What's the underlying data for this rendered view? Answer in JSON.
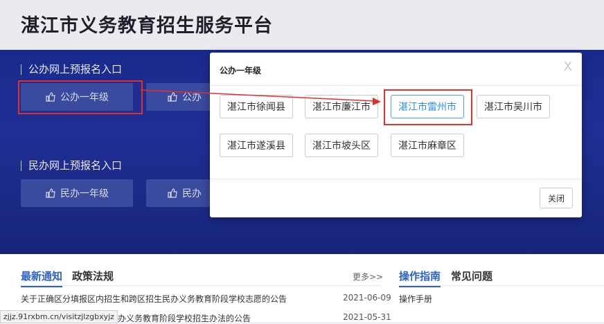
{
  "header": {
    "title": "湛江市义务教育招生服务平台"
  },
  "hero": {
    "public_section": "公办网上预报名入口",
    "private_section": "民办网上预报名入口",
    "public_buttons": [
      "公办一年级",
      "公办"
    ],
    "private_buttons": [
      "民办一年级",
      "民办"
    ]
  },
  "modal": {
    "title": "公办一年级",
    "close_x": "X",
    "cities": [
      "湛江市徐闻县",
      "湛江市廉江市",
      "湛江市雷州市",
      "湛江市吴川市",
      "湛江市遂溪县",
      "湛江市坡头区",
      "湛江市麻章区"
    ],
    "selected_city": "湛江市雷州市",
    "close_button": "关闭"
  },
  "news": {
    "tab_active": "最新通知",
    "tab_other": "政策法规",
    "more": "更多>>",
    "items": [
      {
        "title": "关于正确区分填报区内招生和跨区招生民办义务教育阶段学校志愿的公告",
        "date": "2021-06-09"
      },
      {
        "title": "民办义务教育阶段学校招生办法的公告",
        "date": "2021-05-31"
      }
    ]
  },
  "guide": {
    "tab_active": "操作指南",
    "tab_other": "常见问题",
    "items": [
      "操作手册"
    ]
  },
  "status_bar": {
    "url": "zjjz.91rxbm.cn/visitzjlzgbxyjz"
  },
  "colors": {
    "accent": "#2b62c5",
    "annotation_red": "#e0302a",
    "selected_blue": "#2e8fe0"
  }
}
